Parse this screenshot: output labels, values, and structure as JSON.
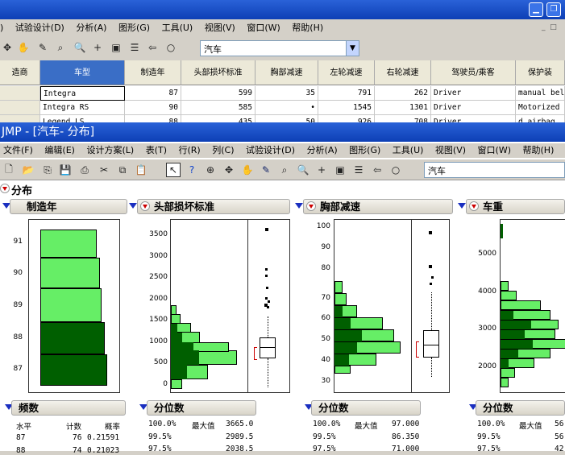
{
  "back_window": {
    "menu": [
      ")",
      "试验设计(D)",
      "分析(A)",
      "图形(G)",
      "工具(U)",
      "视图(V)",
      "窗口(W)",
      "帮助(H)"
    ],
    "combo_value": "汽车",
    "columns": [
      "造商",
      "车型",
      "制造年",
      "头部损坏标准",
      "胸部减速",
      "左轮减速",
      "右轮减速",
      "驾驶员/乘客",
      "保护装"
    ],
    "rows": [
      [
        "",
        "Integra",
        "87",
        "599",
        "35",
        "791",
        "262",
        "Driver",
        "manual bel"
      ],
      [
        "",
        "Integra RS",
        "90",
        "585",
        "•",
        "1545",
        "1301",
        "Driver",
        "Motorized"
      ],
      [
        "",
        "Legend LS",
        "88",
        "435",
        "50",
        "926",
        "708",
        "Driver",
        "d airbag"
      ]
    ]
  },
  "window": {
    "title": "JMP - [汽车- 分布]",
    "menu": [
      "文件(F)",
      "编辑(E)",
      "设计方案(L)",
      "表(T)",
      "行(R)",
      "列(C)",
      "试验设计(D)",
      "分析(A)",
      "图形(G)",
      "工具(U)",
      "视图(V)",
      "窗口(W)",
      "帮助(H)"
    ],
    "combo_value": "汽车",
    "report_title": "分布"
  },
  "panels": {
    "year": {
      "title": "制造年",
      "years": [
        "91",
        "90",
        "89",
        "88",
        "87"
      ]
    },
    "head": {
      "title": "头部损坏标准",
      "ticks": [
        "3500",
        "3000",
        "2500",
        "2000",
        "1500",
        "1000",
        "500",
        "0"
      ]
    },
    "chest": {
      "title": "胸部减速",
      "ticks": [
        "100",
        "90",
        "80",
        "70",
        "60",
        "50",
        "40",
        "30"
      ]
    },
    "weight": {
      "title": "车重",
      "ticks": [
        "5000",
        "4000",
        "3000",
        "2000"
      ]
    }
  },
  "freq": {
    "title": "频数",
    "header": [
      "水平",
      "计数",
      "概率"
    ],
    "rows": [
      [
        "87",
        "76",
        "0.21591"
      ],
      [
        "88",
        "74",
        "0.21023"
      ]
    ]
  },
  "quant1": {
    "title": "分位数",
    "rows": [
      [
        "100.0%",
        "最大值",
        "3665.0"
      ],
      [
        "99.5%",
        "",
        "2989.5"
      ],
      [
        "97.5%",
        "",
        "2038.5"
      ]
    ]
  },
  "quant2": {
    "title": "分位数",
    "rows": [
      [
        "100.0%",
        "最大值",
        "97.000"
      ],
      [
        "99.5%",
        "",
        "86.350"
      ],
      [
        "97.5%",
        "",
        "71.000"
      ]
    ]
  },
  "quant3": {
    "title": "分位数",
    "rows": [
      [
        "100.0%",
        "最大值",
        "56"
      ],
      [
        "99.5%",
        "",
        "56"
      ],
      [
        "97.5%",
        "",
        "42"
      ]
    ]
  },
  "colors": {
    "light_green": "#66ee66",
    "dark_green": "#005f00",
    "title_blue": "#0d3fb5"
  }
}
